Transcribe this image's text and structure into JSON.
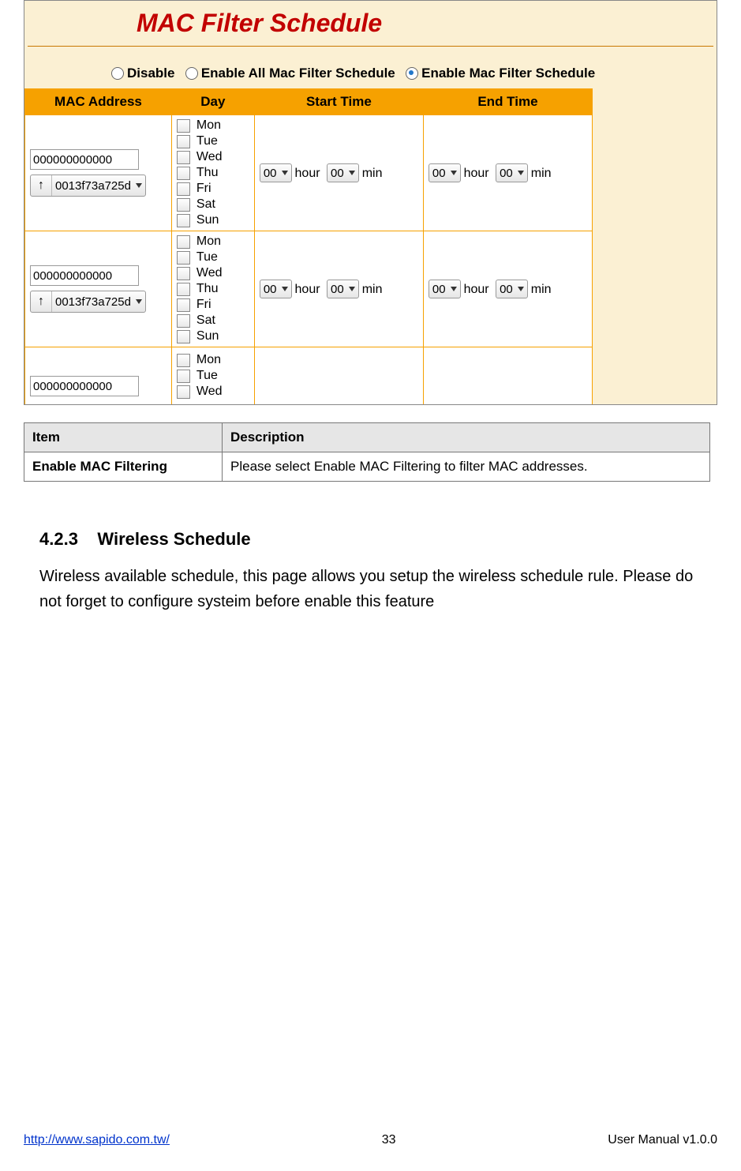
{
  "title": "MAC Filter Schedule",
  "options": {
    "disable": "Disable",
    "enable_all": "Enable All Mac Filter Schedule",
    "enable": "Enable Mac Filter Schedule"
  },
  "headers": {
    "mac": "MAC Address",
    "day": "Day",
    "start": "Start Time",
    "end": "End Time"
  },
  "days": [
    "Mon",
    "Tue",
    "Wed",
    "Thu",
    "Fri",
    "Sat",
    "Sun"
  ],
  "days_partial": [
    "Mon",
    "Tue",
    "Wed"
  ],
  "mac_text": "000000000000",
  "mac_dd": "0013f73a725d",
  "time_val": "00",
  "hour": "hour",
  "min": "min",
  "doc": {
    "h_item": "Item",
    "h_desc": "Description",
    "r1_item": "Enable MAC Filtering",
    "r1_desc": "Please select Enable MAC Filtering to filter MAC addresses."
  },
  "section": {
    "num_title": "4.2.3    Wireless Schedule",
    "para": "Wireless available schedule, this page allows you setup the wireless schedule rule. Please do not forget to configure systeim before enable this feature"
  },
  "footer": {
    "url": "http://www.sapido.com.tw/",
    "page": "33",
    "ver": "User Manual v1.0.0"
  }
}
